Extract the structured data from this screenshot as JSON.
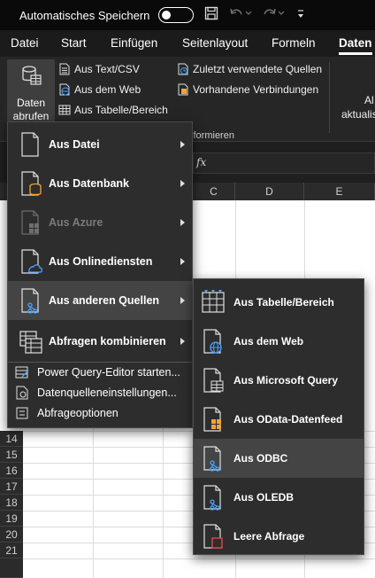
{
  "titlebar": {
    "autosave_label": "Automatisches Speichern"
  },
  "tabs": [
    {
      "label": "Datei"
    },
    {
      "label": "Start"
    },
    {
      "label": "Einfügen"
    },
    {
      "label": "Seitenlayout"
    },
    {
      "label": "Formeln"
    },
    {
      "label": "Daten"
    }
  ],
  "ribbon": {
    "get_data_line1": "Daten",
    "get_data_line2": "abrufen",
    "from_text": "Aus Text/CSV",
    "from_web": "Aus dem Web",
    "from_table": "Aus Tabelle/Bereich",
    "recent_sources": "Zuletzt verwendete Quellen",
    "existing_connections": "Vorhandene Verbindungen",
    "group_label": "sformieren",
    "refresh_line1": "Al",
    "refresh_line2": "aktualisi"
  },
  "formula": {
    "fx": "fx"
  },
  "grid": {
    "columns": [
      "C",
      "D",
      "E"
    ],
    "rows": [
      "14",
      "15",
      "16",
      "17",
      "18",
      "19",
      "20",
      "21"
    ]
  },
  "menu_main": {
    "items": [
      {
        "label": "Aus Datei",
        "arrow": true,
        "disabled": false
      },
      {
        "label": "Aus Datenbank",
        "arrow": true,
        "disabled": false
      },
      {
        "label": "Aus Azure",
        "arrow": true,
        "disabled": true
      },
      {
        "label": "Aus Onlinediensten",
        "arrow": true,
        "disabled": false
      },
      {
        "label": "Aus anderen Quellen",
        "arrow": true,
        "disabled": false,
        "highlighted": true
      },
      {
        "label": "Abfragen kombinieren",
        "arrow": true,
        "disabled": false
      }
    ],
    "small_items": [
      {
        "label": "Power Query-Editor starten..."
      },
      {
        "label": "Datenquelleneinstellungen..."
      },
      {
        "label": "Abfrageoptionen"
      }
    ]
  },
  "menu_sub": {
    "items": [
      {
        "label": "Aus Tabelle/Bereich"
      },
      {
        "label": "Aus dem Web"
      },
      {
        "label": "Aus Microsoft Query"
      },
      {
        "label": "Aus OData-Datenfeed"
      },
      {
        "label": "Aus ODBC",
        "highlighted": true
      },
      {
        "label": "Aus OLEDB"
      },
      {
        "label": "Leere Abfrage"
      }
    ]
  },
  "colors": {
    "accent_orange": "#f2a33a",
    "link_blue": "#4aa3ff",
    "highlight": "#444444"
  }
}
